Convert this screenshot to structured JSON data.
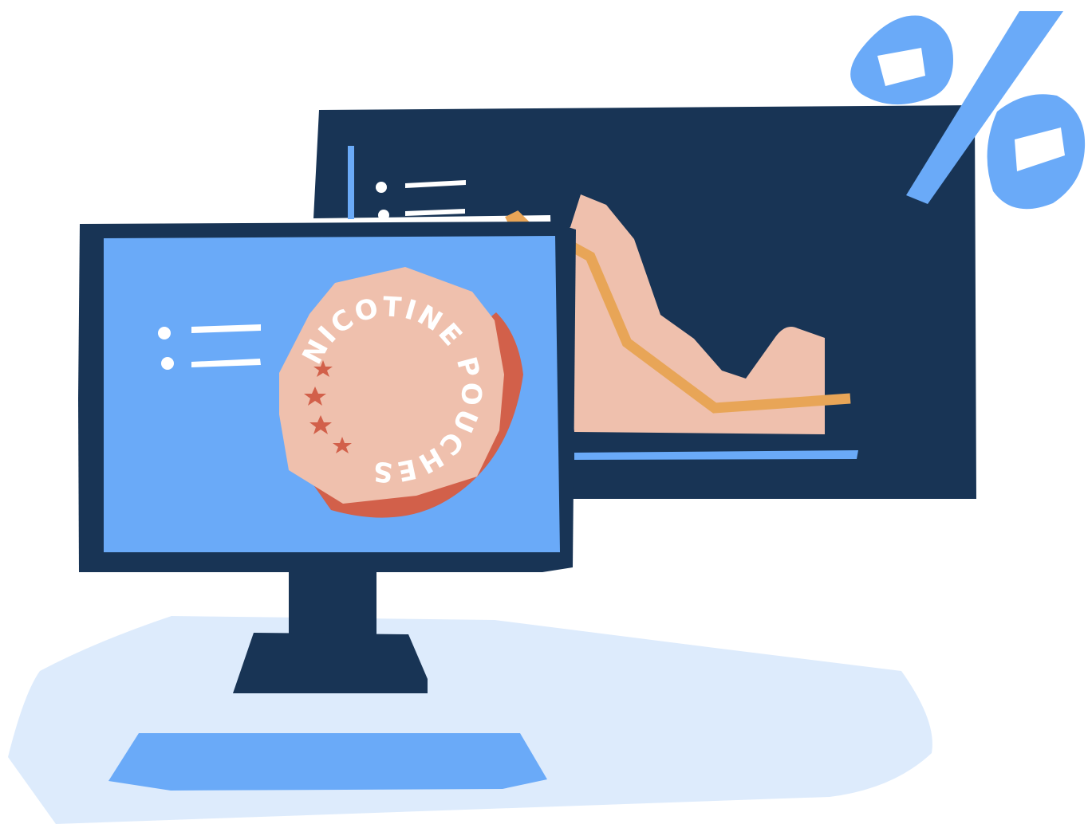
{
  "illustration": {
    "pouch_label": "NICOTINE POUCHES",
    "percent_symbol": "%",
    "stars_count": 4
  },
  "colors": {
    "navy": "#183455",
    "blue": "#6AAAF8",
    "light_blue": "#DDEBFC",
    "pink": "#EFC0AD",
    "red": "#D2604A",
    "orange": "#E8A557",
    "white": "#FFFFFF"
  },
  "icons": {
    "percent": "percent-icon",
    "star": "star-icon",
    "list": "list-icon",
    "chart": "area-chart-icon"
  }
}
